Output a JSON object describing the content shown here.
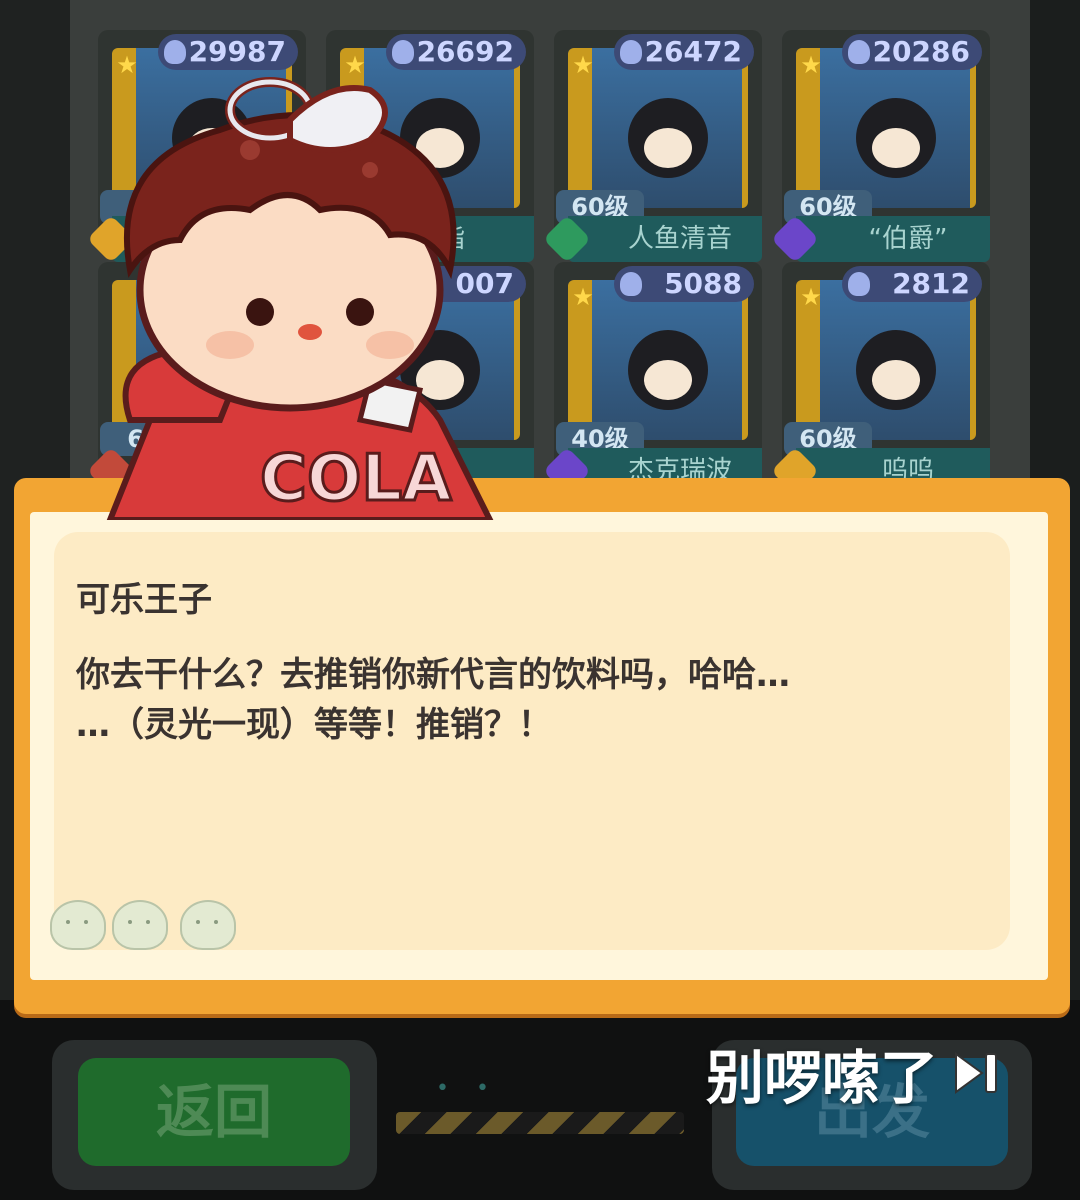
{
  "roster": {
    "cards": [
      {
        "power": "29987",
        "level": "6",
        "name": "",
        "rank_color": "#e0a42a"
      },
      {
        "power": "26692",
        "level": "",
        "name": "指",
        "rank_color": "#e0a42a"
      },
      {
        "power": "26472",
        "level": "60级",
        "name": "人鱼清音",
        "rank_color": "#2e9a5e"
      },
      {
        "power": "20286",
        "level": "60级",
        "name": "“伯爵”",
        "rank_color": "#6b46c9"
      },
      {
        "power": "",
        "level": "60",
        "name": "",
        "rank_color": "#c24a3a"
      },
      {
        "power": "007",
        "level": "",
        "name": "攻",
        "rank_color": "#6b46c9"
      },
      {
        "power": "5088",
        "level": "40级",
        "name": "杰克瑞波",
        "rank_color": "#6b46c9"
      },
      {
        "power": "2812",
        "level": "60级",
        "name": "呜呜",
        "rank_color": "#e0a42a"
      }
    ]
  },
  "dialog": {
    "speaker": "可乐王子",
    "line1": "你去干什么？去推销你新代言的饮料吗，哈哈…",
    "line2": "…（灵光一现）等等！推销？！",
    "character_shirt": "COLA"
  },
  "controls": {
    "back_label": "返回",
    "go_label": "出发",
    "skip_label": "别啰嗦了"
  },
  "colors": {
    "dialog_border": "#f2a533",
    "dialog_bg": "#fff6dc",
    "back_button": "#1f6b2c",
    "go_button": "#16516a"
  }
}
